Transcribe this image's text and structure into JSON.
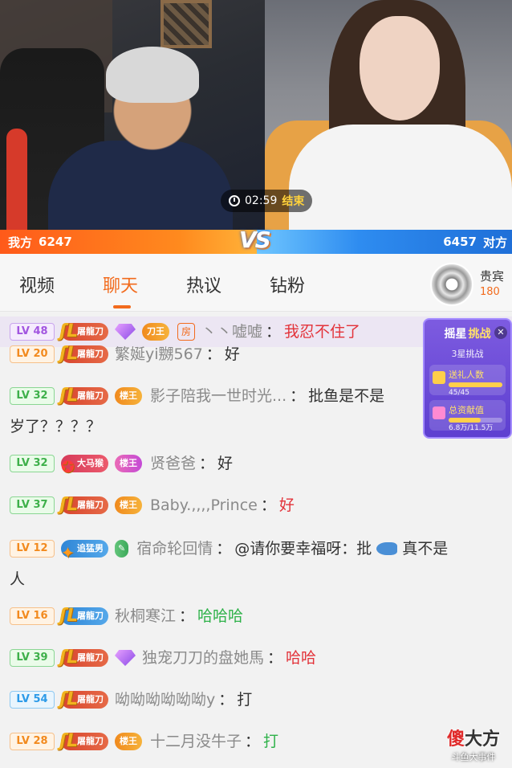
{
  "video": {
    "timer": "02:59",
    "end_label": "结束"
  },
  "pk": {
    "left_label": "我方",
    "left_score": "6247",
    "vs": "VS",
    "right_score": "6457",
    "right_label": "对方"
  },
  "tabs": [
    "视频",
    "聊天",
    "热议",
    "钻粉"
  ],
  "active_tab": "聊天",
  "guest": {
    "label": "贵宾",
    "count": "180"
  },
  "challenge": {
    "title_a": "摇星",
    "title_b": "挑战",
    "level": "3星挑战",
    "task1_label": "送礼人数",
    "task1_value": "45/45",
    "task1_progress": 1.0,
    "task2_label": "总资献值",
    "task2_value": "6.8万/11.5万",
    "task2_progress": 0.59
  },
  "messages": [
    {
      "lv": "LV 48",
      "lv_color": "purple",
      "badge": "屠龍刀",
      "fan": "刀王",
      "tag": "房",
      "user": "丶丶嘘嘘",
      "content": "我忍不住了",
      "content_color": "red",
      "highlight": true
    },
    {
      "lv": "LV 20",
      "lv_color": "orange",
      "badge": "屠龍刀",
      "user": "繁娫yi嬲567",
      "content": "好"
    },
    {
      "lv": "LV 32",
      "lv_color": "green",
      "badge": "屠龍刀",
      "fan": "楼王",
      "user": "影子陪我一世时光...",
      "content": "批鱼是不是",
      "cont2": "岁了？？？？"
    },
    {
      "lv": "LV 32",
      "lv_color": "green",
      "badge": "大马猴",
      "fan": "楼王",
      "user": "贤爸爸",
      "content": "好"
    },
    {
      "lv": "LV 37",
      "lv_color": "green",
      "badge": "屠龍刀",
      "fan": "楼王",
      "user": "Baby.,,,,Prince",
      "content": "好",
      "content_color": "red"
    },
    {
      "lv": "LV 12",
      "lv_color": "orange",
      "badge": "追猛男",
      "user": "宿命轮回情",
      "content": "@请你要幸福呀：批",
      "content_tail": "真不是",
      "cont2": "人"
    },
    {
      "lv": "LV 16",
      "lv_color": "orange",
      "badge": "屠龍刀",
      "user": "秋桐寒江",
      "content": "哈哈哈",
      "content_color": "green"
    },
    {
      "lv": "LV 39",
      "lv_color": "green",
      "badge": "屠龍刀",
      "user": "独宠刀刀的盘她馬",
      "content": "哈哈",
      "content_color": "red"
    },
    {
      "lv": "LV 54",
      "lv_color": "blue",
      "badge": "屠龍刀",
      "user": "呦呦呦呦呦呦y",
      "content": "打"
    },
    {
      "lv": "LV 28",
      "lv_color": "orange",
      "badge": "屠龍刀",
      "fan": "楼王",
      "user": "十二月没牛子",
      "content": "打",
      "content_color": "green"
    }
  ],
  "watermark": {
    "big_a": "傻",
    "big_b": "大方",
    "small": "斗鱼大事件"
  }
}
